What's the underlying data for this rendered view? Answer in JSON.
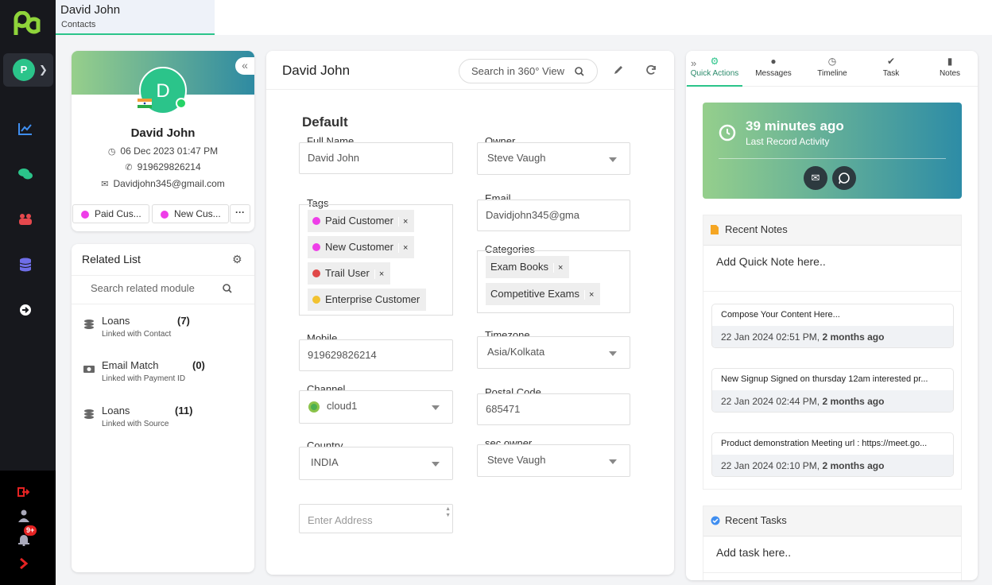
{
  "brand": {
    "accent": "#2bc48a",
    "sidebar_bg": "#17181d"
  },
  "sidebar": {
    "user_initial": "P",
    "notification_count": "9+",
    "nav_icons": [
      "analytics-icon",
      "chat-icon",
      "users-icon",
      "database-icon",
      "arrow-right-circle-icon"
    ],
    "bottom_icons": [
      "logout-icon",
      "user-icon",
      "bell-icon",
      "chevron-right-icon"
    ]
  },
  "top_tab": {
    "title": "David John",
    "subtitle": "Contacts"
  },
  "profile": {
    "initial": "D",
    "name": "David John",
    "date": "06 Dec 2023 01:47 PM",
    "phone": "919629826214",
    "email": "Davidjohn345@gmail.com",
    "chips": [
      {
        "label": "Paid Cus...",
        "color": "#ee3ee8"
      },
      {
        "label": "New Cus...",
        "color": "#ee3ee8"
      }
    ],
    "more": "···"
  },
  "related": {
    "title": "Related List",
    "search_placeholder": "Search related module",
    "items": [
      {
        "name": "Loans",
        "count": "(7)",
        "sub": "Linked with Contact"
      },
      {
        "name": "Email Match",
        "count": "(0)",
        "sub": "Linked with Payment ID"
      },
      {
        "name": "Loans",
        "count": "(11)",
        "sub": "Linked with Source"
      }
    ]
  },
  "main": {
    "title": "David John",
    "search_placeholder": "Search in 360° View",
    "section": "Default",
    "fields": {
      "full_name": {
        "label": "Full Name",
        "value": "David John"
      },
      "owner": {
        "label": "Owner",
        "value": "Steve Vaugh"
      },
      "tags": {
        "label": "Tags",
        "items": [
          {
            "label": "Paid Customer",
            "color": "#ee3ee8"
          },
          {
            "label": "New Customer",
            "color": "#ee3ee8"
          },
          {
            "label": "Trail User",
            "color": "#e04848"
          },
          {
            "label": "Enterprise Customer",
            "color": "#f2c230"
          }
        ]
      },
      "email": {
        "label": "Email",
        "value": "Davidjohn345@gma"
      },
      "categories": {
        "label": "Categories",
        "items": [
          "Exam Books",
          "Competitive Exams"
        ]
      },
      "mobile": {
        "label": "Mobile",
        "value": "919629826214"
      },
      "timezone": {
        "label": "Timezone",
        "value": "Asia/Kolkata"
      },
      "channel": {
        "label": "Channel",
        "value": "cloud1"
      },
      "postal": {
        "label": "Postal Code",
        "value": "685471"
      },
      "country": {
        "label": "Country",
        "value": "INDIA"
      },
      "sec_owner": {
        "label": "sec owner",
        "value": "Steve Vaugh"
      },
      "address": {
        "placeholder": "Enter Address"
      }
    },
    "remove_glyph": "×"
  },
  "right": {
    "tabs": [
      "Quick Actions",
      "Messages",
      "Timeline",
      "Task",
      "Notes"
    ],
    "activity": {
      "time": "39 minutes ago",
      "label": "Last Record Activity"
    },
    "notes": {
      "title": "Recent Notes",
      "placeholder": "Add Quick Note here..",
      "items": [
        {
          "body": "Compose Your Content Here...",
          "date": "22 Jan 2024 02:51 PM,",
          "ago": "2 months ago"
        },
        {
          "body": "New Signup Signed on thursday  12am   interested pr...",
          "date": "22 Jan 2024 02:44 PM,",
          "ago": "2 months ago"
        },
        {
          "body": "Product demonstration  Meeting url : https://meet.go...",
          "date": "22 Jan 2024 02:10 PM,",
          "ago": "2 months ago"
        }
      ]
    },
    "tasks": {
      "title": "Recent Tasks",
      "placeholder": "Add task here.."
    }
  }
}
